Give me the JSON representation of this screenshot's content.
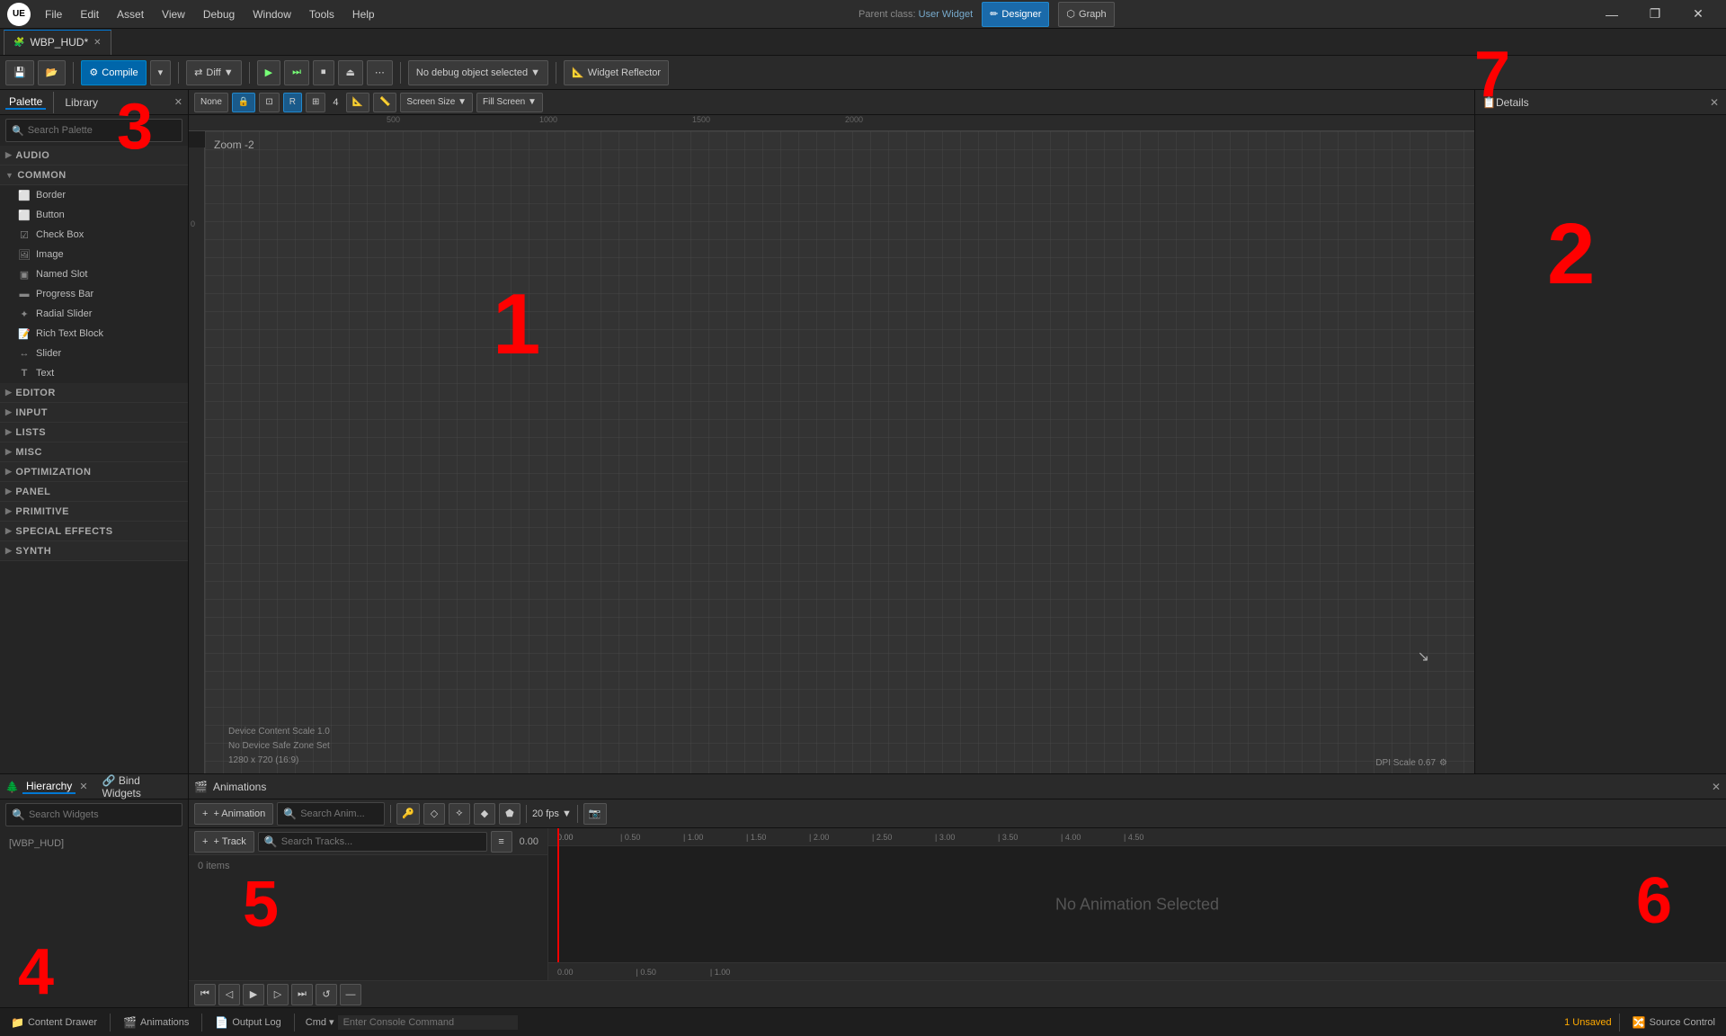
{
  "titleBar": {
    "logo": "UE",
    "menus": [
      "File",
      "Edit",
      "Asset",
      "View",
      "Debug",
      "Window",
      "Tools",
      "Help"
    ],
    "controls": [
      "—",
      "❐",
      "✕"
    ],
    "parentLabel": "Parent class:",
    "parentClass": "User Widget",
    "designerLabel": "Designer",
    "graphLabel": "Graph"
  },
  "tabBar": {
    "tabs": [
      {
        "icon": "🧩",
        "label": "WBP_HUD*",
        "active": true
      }
    ]
  },
  "toolbar": {
    "compile": "Compile",
    "diff": "Diff ▼",
    "playTooltip": "Play",
    "debugSelector": "No debug object selected ▼",
    "widgetReflector": "Widget Reflector"
  },
  "palette": {
    "panelTitle": "Palette",
    "libraryTab": "Library",
    "searchPlaceholder": "Search Palette",
    "sections": [
      {
        "name": "AUDIO",
        "expanded": false,
        "items": []
      },
      {
        "name": "COMMON",
        "expanded": true,
        "items": [
          {
            "icon": "⬜",
            "label": "Border"
          },
          {
            "icon": "⬜",
            "label": "Button"
          },
          {
            "icon": "☑",
            "label": "Check Box"
          },
          {
            "icon": "🖼",
            "label": "Image"
          },
          {
            "icon": "📦",
            "label": "Named Slot"
          },
          {
            "icon": "▬",
            "label": "Progress Bar"
          },
          {
            "icon": "✦",
            "label": "Radial Slider"
          },
          {
            "icon": "📝",
            "label": "Rich Text Block"
          },
          {
            "icon": "↔",
            "label": "Slider"
          },
          {
            "icon": "T",
            "label": "Text"
          }
        ]
      },
      {
        "name": "EDITOR",
        "expanded": false,
        "items": []
      },
      {
        "name": "INPUT",
        "expanded": false,
        "items": []
      },
      {
        "name": "LISTS",
        "expanded": false,
        "items": []
      },
      {
        "name": "MISC",
        "expanded": false,
        "items": []
      },
      {
        "name": "OPTIMIZATION",
        "expanded": false,
        "items": []
      },
      {
        "name": "PANEL",
        "expanded": false,
        "items": []
      },
      {
        "name": "PRIMITIVE",
        "expanded": false,
        "items": []
      },
      {
        "name": "SPECIAL EFFECTS",
        "expanded": false,
        "items": []
      },
      {
        "name": "SYNTH",
        "expanded": false,
        "items": []
      }
    ]
  },
  "canvas": {
    "zoomLabel": "Zoom -2",
    "screenSizeLabel": "Screen Size ▼",
    "fillScreenLabel": "Fill Screen ▼",
    "deviceScale": "Device Content Scale 1.0",
    "safeZone": "No Device Safe Zone Set",
    "resolution": "1280 x 720 (16:9)",
    "dpiScale": "DPI Scale 0.67",
    "rulerMarks": [
      "500",
      "1000",
      "1500",
      "2000"
    ],
    "gridValue": "R",
    "gridNum": "4",
    "noneLabel": "None"
  },
  "details": {
    "title": "Details"
  },
  "hierarchy": {
    "title": "Hierarchy",
    "bindWidgets": "Bind Widgets",
    "searchPlaceholder": "Search Widgets",
    "rootItem": "[WBP_HUD]"
  },
  "animations": {
    "panelTitle": "Animations",
    "addAnimLabel": "+ Animation",
    "searchPlaceholder": "Search Anim...",
    "trackLabel": "+ Track",
    "searchTracksPlaceholder": "Search Tracks...",
    "itemsCount": "0 items",
    "noAnimLabel": "No Animation Selected",
    "fps": "20 fps ▼",
    "timeValue": "0.00",
    "timelineTicks": [
      "0.00",
      "0.50",
      "1.00",
      "1.50",
      "2.00",
      "2.50",
      "3.00",
      "3.50",
      "4.00",
      "4.50"
    ]
  },
  "statusBar": {
    "contentDrawer": "Content Drawer",
    "animations": "Animations",
    "outputLog": "Output Log",
    "cmdPlaceholder": "Enter Console Command",
    "unsaved": "1 Unsaved",
    "sourceControl": "Source Control"
  },
  "annotations": {
    "num1": "1",
    "num2": "2",
    "num3": "3",
    "num4": "4",
    "num5": "5",
    "num6": "6",
    "num7": "7"
  }
}
